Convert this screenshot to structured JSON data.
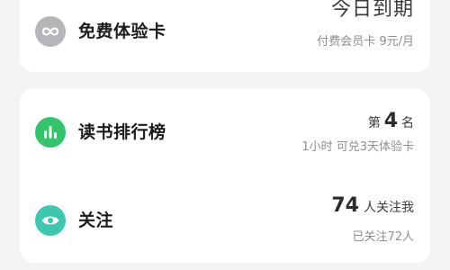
{
  "free_card": {
    "icon": "infinity-icon",
    "title": "免费体验卡",
    "status": "今日到期",
    "price_note": "付费会员卡 9元/月"
  },
  "rank": {
    "icon": "bar-chart-icon",
    "title": "读书排行榜",
    "prefix": "第",
    "number": "4",
    "suffix": "名",
    "note": "1小时 可兑3天体验卡"
  },
  "follow": {
    "icon": "eye-icon",
    "title": "关注",
    "count": "74",
    "count_suffix": "人关注我",
    "following": "已关注72人"
  },
  "colors": {
    "background": "#f3f4f6",
    "card": "#ffffff",
    "icon_gray": "#b4b6ba",
    "icon_green": "#34c46b",
    "icon_teal": "#3cc7ae"
  }
}
